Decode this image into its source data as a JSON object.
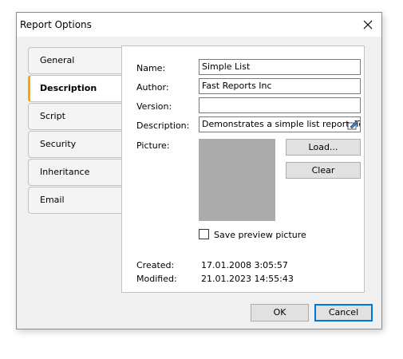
{
  "window": {
    "title": "Report Options"
  },
  "tabs": [
    {
      "label": "General"
    },
    {
      "label": "Description"
    },
    {
      "label": "Script"
    },
    {
      "label": "Security"
    },
    {
      "label": "Inheritance"
    },
    {
      "label": "Email"
    }
  ],
  "active_tab": "Description",
  "form": {
    "name_label": "Name:",
    "name_value": "Simple List",
    "author_label": "Author:",
    "author_value": "Fast Reports Inc",
    "version_label": "Version:",
    "version_value": "",
    "description_label": "Description:",
    "description_value": "Demonstrates a simple list report. To c",
    "picture_label": "Picture:",
    "load_label": "Load...",
    "clear_label": "Clear",
    "save_preview_label": "Save preview picture",
    "save_preview_checked": false,
    "created_label": "Created:",
    "created_value": "17.01.2008 3:05:57",
    "modified_label": "Modified:",
    "modified_value": "21.01.2023 14:55:43"
  },
  "buttons": {
    "ok_label": "OK",
    "cancel_label": "Cancel"
  },
  "colors": {
    "active_tab_accent": "#f2a900",
    "default_button_border": "#0078d7",
    "picture_placeholder": "#ababab"
  },
  "icons": {
    "close": "close-icon",
    "edit": "edit-text-icon"
  }
}
